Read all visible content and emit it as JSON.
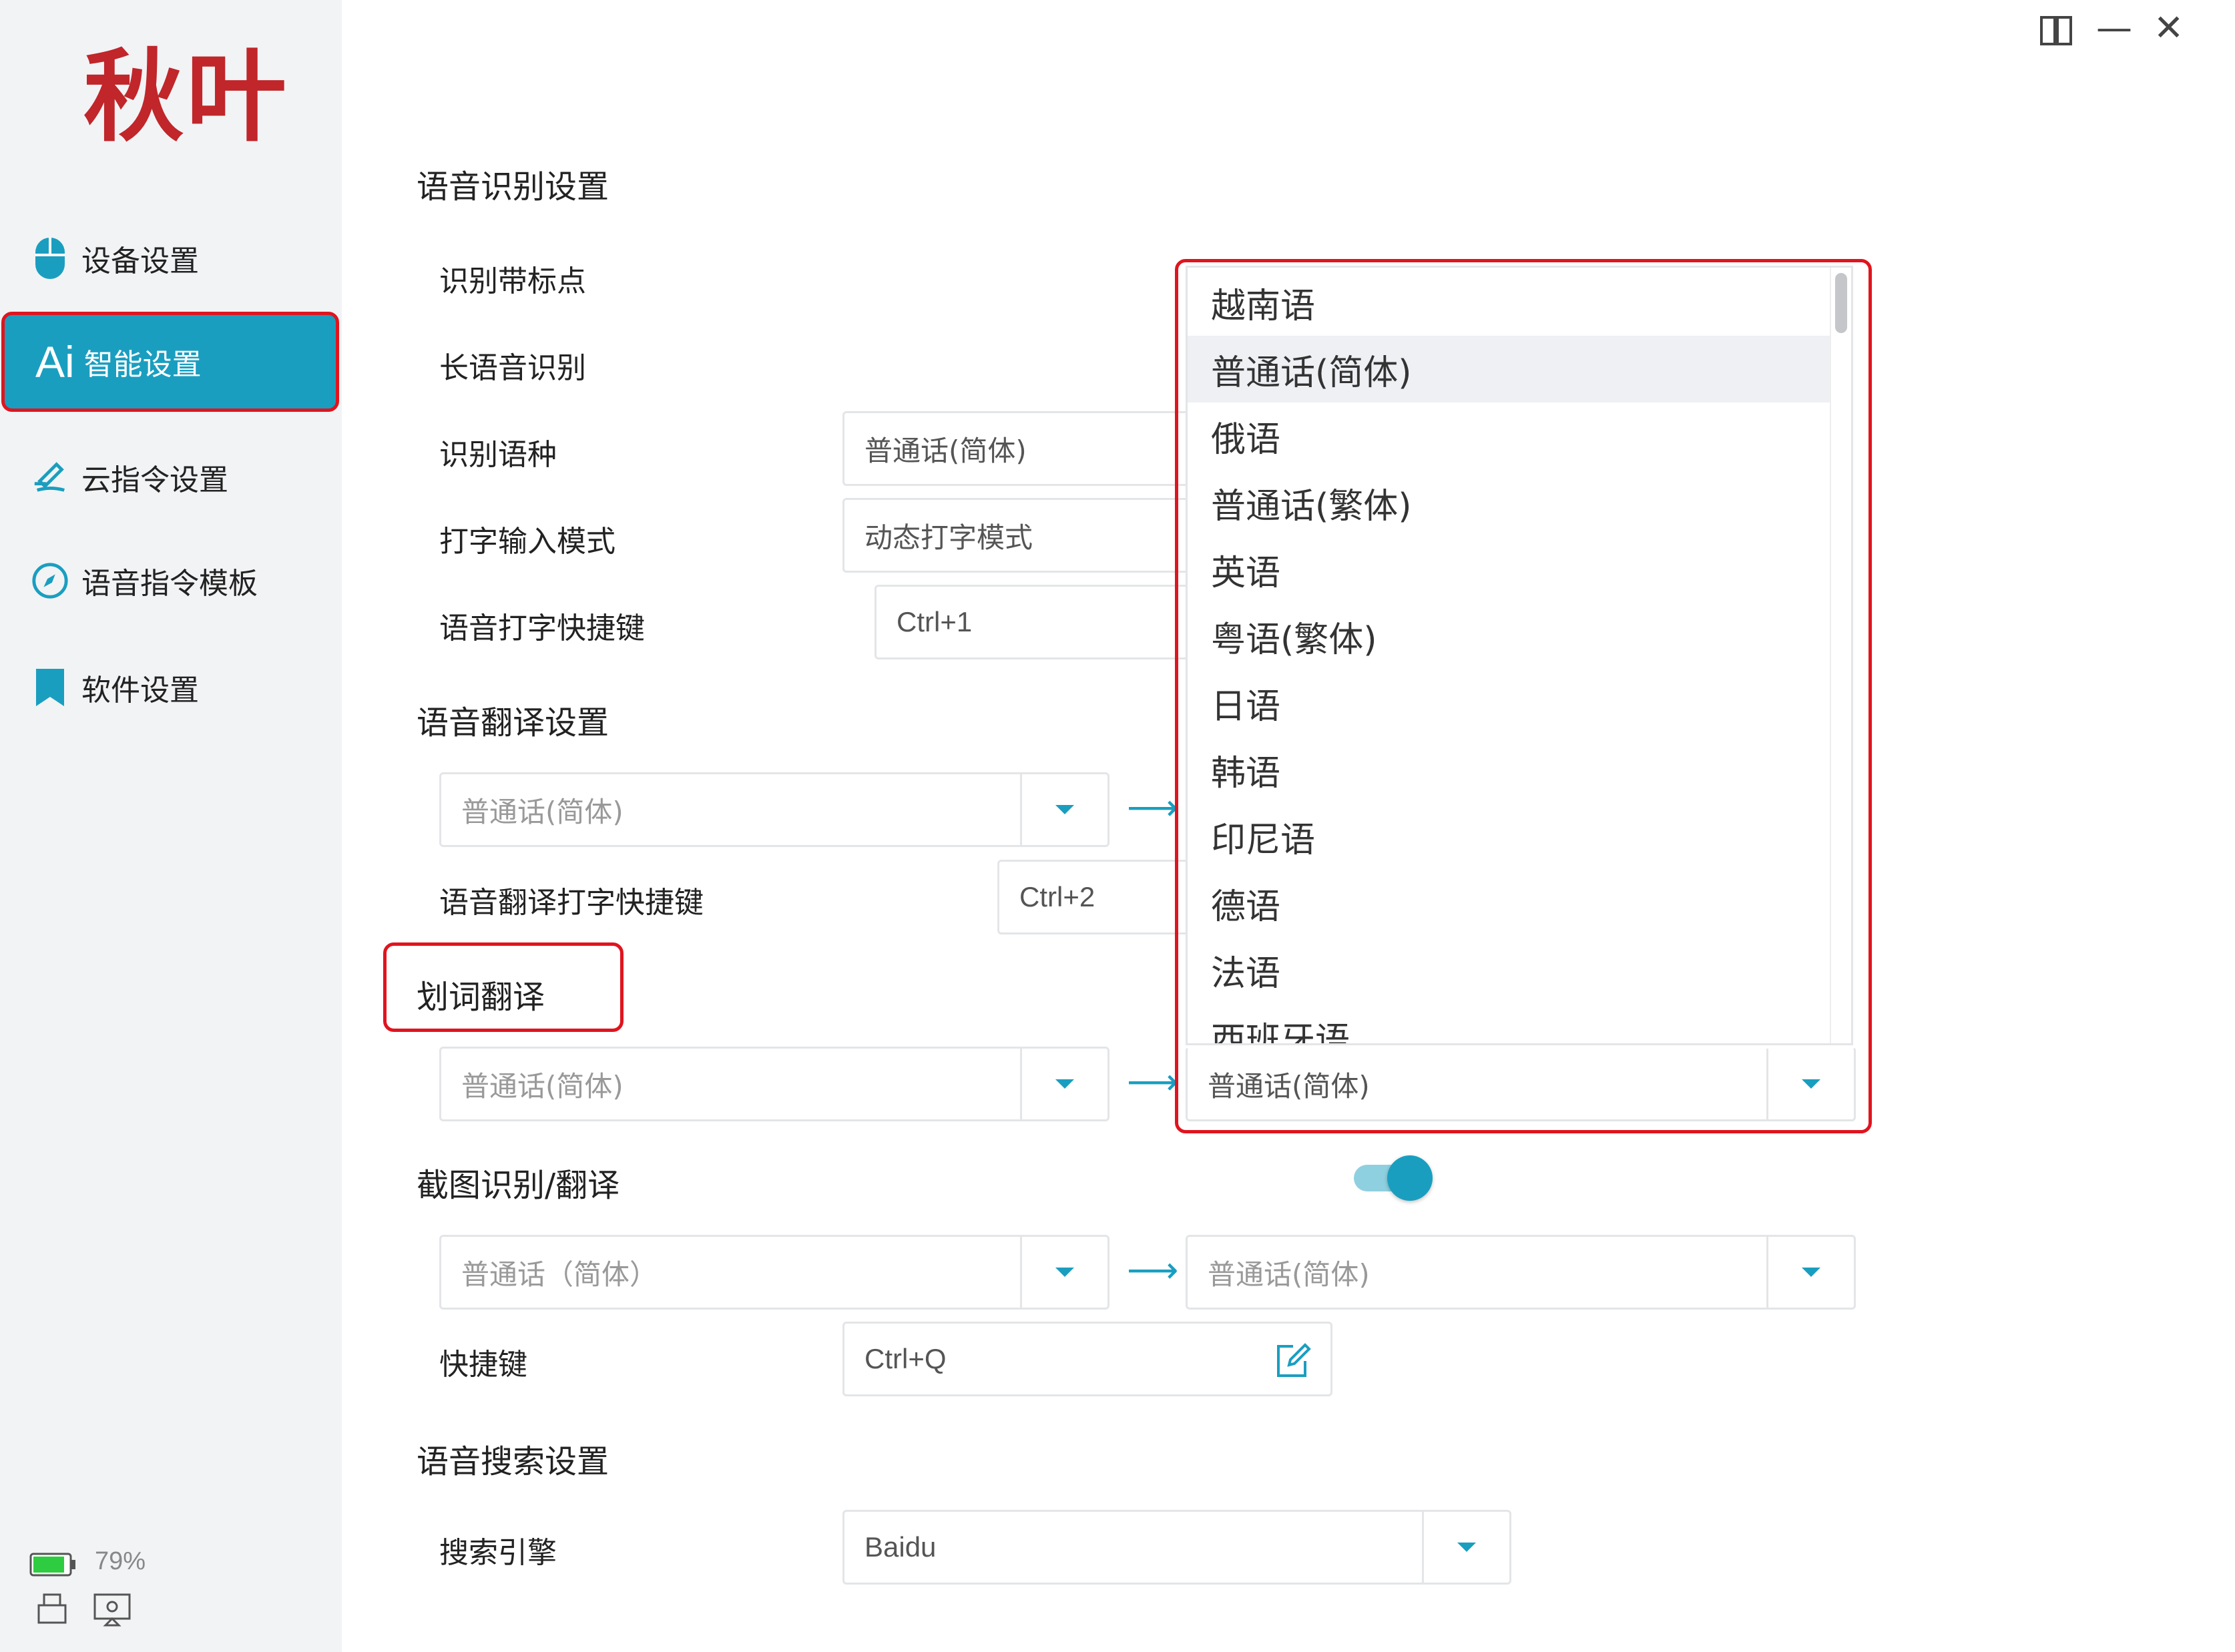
{
  "app": {
    "logo_text": "秋叶"
  },
  "window_controls": {
    "pin": "⊐",
    "minimize": "—",
    "close": "✕"
  },
  "sidebar": {
    "items": [
      {
        "label": "设备设置",
        "icon": "mouse-icon"
      },
      {
        "label": "智能设置",
        "icon": "ai-icon",
        "icon_text": "Ai",
        "active": true
      },
      {
        "label": "云指令设置",
        "icon": "cloud-command-icon"
      },
      {
        "label": "语音指令模板",
        "icon": "compass-icon"
      },
      {
        "label": "软件设置",
        "icon": "bookmark-icon"
      }
    ],
    "battery": "79%"
  },
  "speech_recognition": {
    "title": "语音识别设置",
    "punctuation_label": "识别带标点",
    "long_speech_label": "长语音识别",
    "language_label": "识别语种",
    "language_value": "普通话(简体)",
    "typing_mode_label": "打字输入模式",
    "typing_mode_value": "动态打字模式",
    "hotkey_label": "语音打字快捷键",
    "hotkey_value": "Ctrl+1"
  },
  "speech_translation": {
    "title": "语音翻译设置",
    "source_value": "普通话(简体)",
    "hotkey_label": "语音翻译打字快捷键",
    "hotkey_value": "Ctrl+2"
  },
  "word_translation": {
    "title": "划词翻译",
    "source_value": "普通话(简体)",
    "target_value": "普通话(简体)"
  },
  "screenshot_translation": {
    "title": "截图识别/翻译",
    "enabled": true,
    "source_value": "普通话（简体）",
    "target_value": "普通话(简体)",
    "hotkey_label": "快捷键",
    "hotkey_value": "Ctrl+Q"
  },
  "voice_search": {
    "title": "语音搜索设置",
    "engine_label": "搜索引擎",
    "engine_value": "Baidu"
  },
  "dropdown_options": [
    "越南语",
    "普通话(简体)",
    "俄语",
    "普通话(繁体)",
    "英语",
    "粤语(繁体)",
    "日语",
    "韩语",
    "印尼语",
    "德语",
    "法语",
    "西班牙语"
  ],
  "dropdown_selected": "普通话(简体)",
  "colors": {
    "accent": "#1a9ec0",
    "highlight_red": "#e0141e",
    "logo_red": "#c0262a"
  }
}
